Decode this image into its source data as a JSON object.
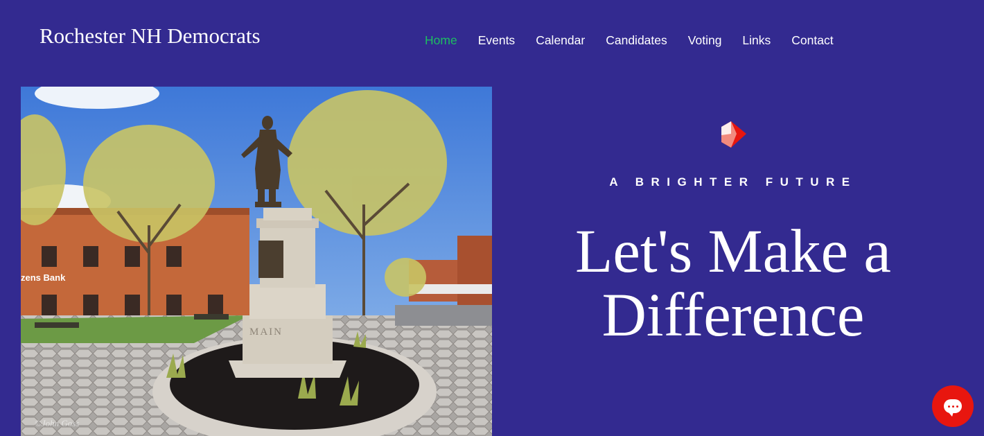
{
  "site": {
    "title": "Rochester NH Democrats"
  },
  "nav": {
    "items": [
      {
        "label": "Home",
        "active": true
      },
      {
        "label": "Events"
      },
      {
        "label": "Calendar"
      },
      {
        "label": "Candidates"
      },
      {
        "label": "Voting"
      },
      {
        "label": "Links"
      },
      {
        "label": "Contact"
      }
    ]
  },
  "hero": {
    "tagline": "A BRIGHTER FUTURE",
    "headline_line1": "Let's Make a",
    "headline_line2": "Difference",
    "photo": {
      "sign_text": "zens Bank",
      "pedestal_text": "MAIN",
      "credit": "©John Goss"
    }
  },
  "chat": {
    "icon": "chat-icon"
  },
  "colors": {
    "background": "#332A90",
    "nav_active": "#1DBE61",
    "chat_button": "#E8160F",
    "text": "#FFFFFF"
  }
}
